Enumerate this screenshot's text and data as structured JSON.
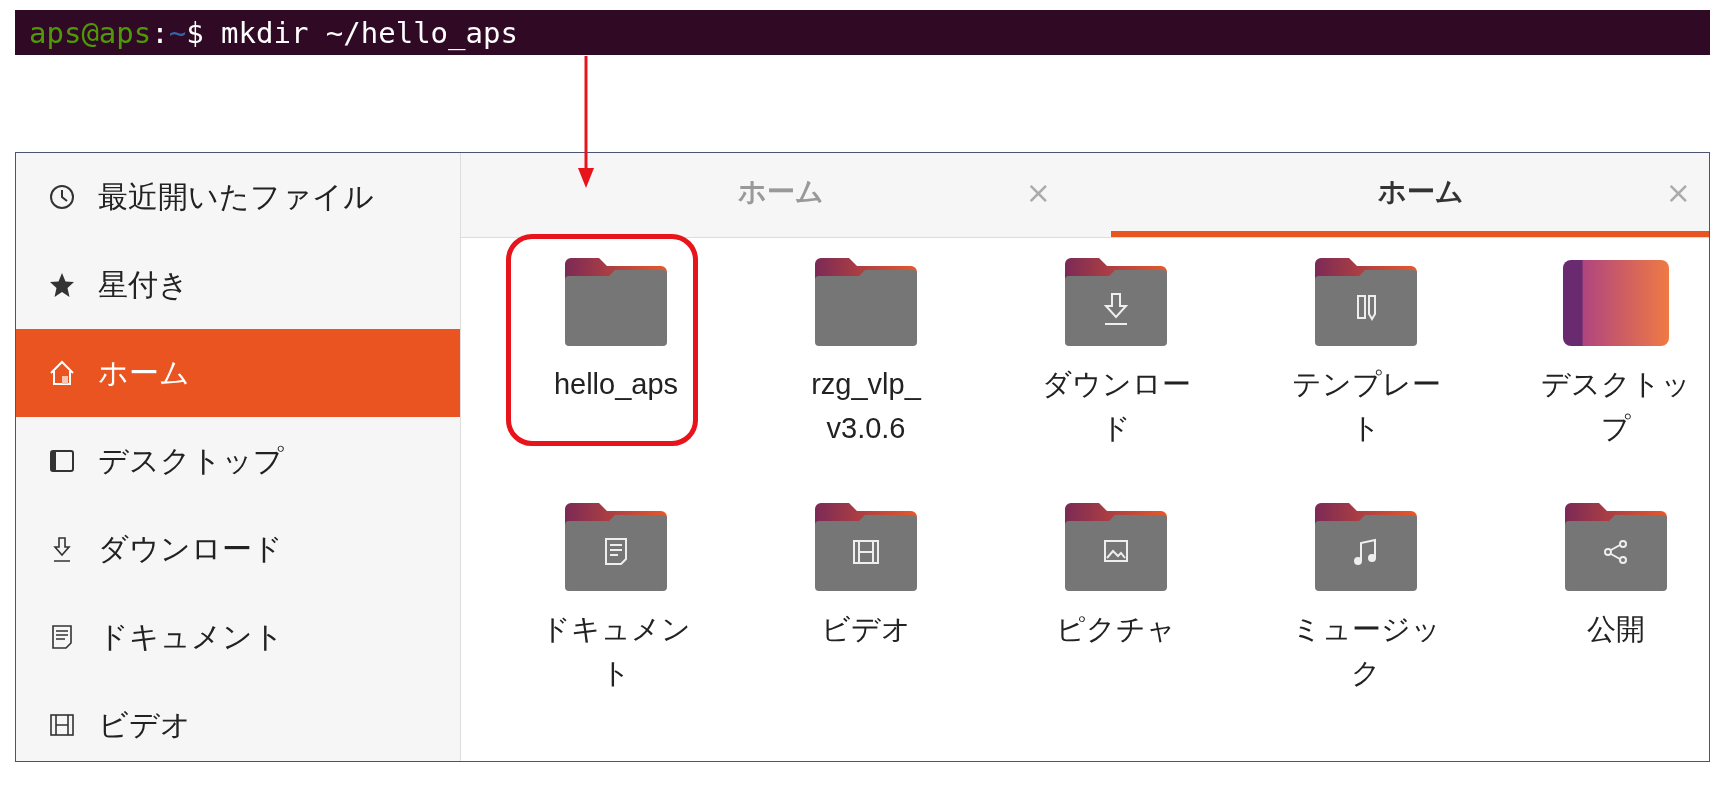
{
  "terminal": {
    "user_host": "aps@aps",
    "separator": ":",
    "path": "~",
    "symbol": "$",
    "command": "mkdir ~/hello_aps"
  },
  "sidebar": {
    "items": [
      {
        "label": "最近開いたファイル",
        "kind": "clock",
        "selected": false
      },
      {
        "label": "星付き",
        "kind": "star",
        "selected": false
      },
      {
        "label": "ホーム",
        "kind": "home",
        "selected": true
      },
      {
        "label": "デスクトップ",
        "kind": "desktop",
        "selected": false
      },
      {
        "label": "ダウンロード",
        "kind": "download",
        "selected": false
      },
      {
        "label": "ドキュメント",
        "kind": "document",
        "selected": false
      },
      {
        "label": "ビデオ",
        "kind": "video",
        "selected": false
      }
    ]
  },
  "tabs": [
    {
      "label": "ホーム",
      "close": "×",
      "selected": false
    },
    {
      "label": "ホーム",
      "close": "×",
      "selected": true
    }
  ],
  "files": [
    {
      "label": "hello_aps",
      "kind": "folder",
      "highlighted": true
    },
    {
      "label": "rzg_vlp_ v3.0.6",
      "kind": "folder",
      "highlighted": false
    },
    {
      "label": "ダウンロード",
      "kind": "download",
      "highlighted": false
    },
    {
      "label": "テンプレート",
      "kind": "template",
      "highlighted": false
    },
    {
      "label": "デスクトップ",
      "kind": "desktop",
      "highlighted": false
    },
    {
      "label": "ドキュメント",
      "kind": "document",
      "highlighted": false
    },
    {
      "label": "ビデオ",
      "kind": "video",
      "highlighted": false
    },
    {
      "label": "ピクチャ",
      "kind": "picture",
      "highlighted": false
    },
    {
      "label": "ミュージック",
      "kind": "music",
      "highlighted": false
    },
    {
      "label": "公開",
      "kind": "share",
      "highlighted": false
    }
  ]
}
